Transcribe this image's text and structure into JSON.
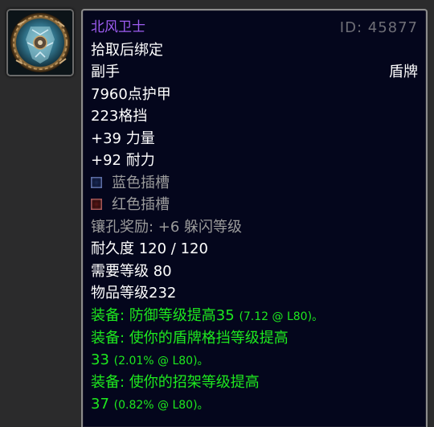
{
  "item": {
    "name": "北风卫士",
    "id_label": "ID: 45877",
    "icon": "shield-icon",
    "bind": "拾取后绑定",
    "slot": "副手",
    "type": "盾牌",
    "armor": "7960点护甲",
    "block": "223格挡",
    "strength": "+39 力量",
    "stamina": "+92 耐力",
    "socket_blue": "蓝色插槽",
    "socket_red": "红色插槽",
    "socket_bonus": "镶孔奖励: +6 躲闪等级",
    "durability": "耐久度 120 / 120",
    "required_level": "需要等级 80",
    "item_level": "物品等级232",
    "equip": [
      {
        "prefix": "装备: ",
        "text": "防御等级提高35",
        "detail": "(7.12 @ L80)。"
      },
      {
        "prefix": "装备: ",
        "text": "使你的盾牌格挡等级提高",
        "value": "33",
        "detail": "(2.01% @ L80)。"
      },
      {
        "prefix": "装备: ",
        "text": "使你的招架等级提高",
        "value": "37",
        "detail": "(0.82% @ L80)。"
      }
    ]
  },
  "colors": {
    "epic": "#9d5cf0",
    "equip_green": "#1ee91e",
    "tooltip_bg": "#04061c",
    "gray_text": "#9b9b9b"
  }
}
